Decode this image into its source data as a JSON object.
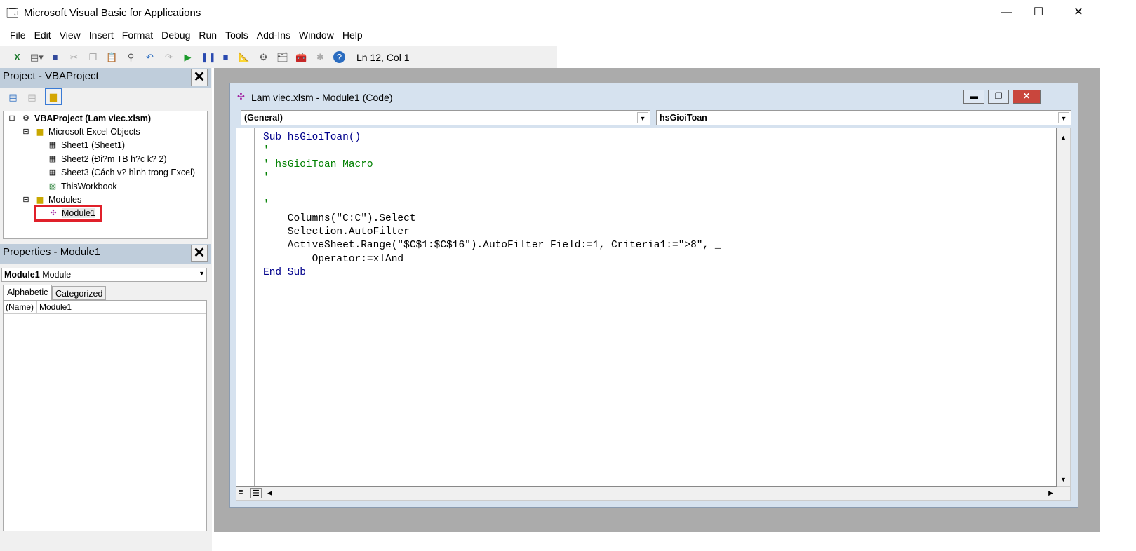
{
  "app": {
    "title": "Microsoft Visual Basic for Applications"
  },
  "menu": [
    "File",
    "Edit",
    "View",
    "Insert",
    "Format",
    "Debug",
    "Run",
    "Tools",
    "Add-Ins",
    "Window",
    "Help"
  ],
  "toolbar": {
    "position": "Ln 12, Col 1"
  },
  "project": {
    "title": "Project - VBAProject",
    "root": "VBAProject (Lam viec.xlsm)",
    "folder1": "Microsoft Excel Objects",
    "items": [
      "Sheet1 (Sheet1)",
      "Sheet2 (Đi?m TB h?c k? 2)",
      "Sheet3 (Cách v? hình trong Excel)",
      "ThisWorkbook"
    ],
    "folder2": "Modules",
    "module": "Module1"
  },
  "properties": {
    "title": "Properties - Module1",
    "object_name": "Module1",
    "object_type": "Module",
    "tabs": [
      "Alphabetic",
      "Categorized"
    ],
    "rows": [
      {
        "name": "(Name)",
        "value": "Module1"
      }
    ]
  },
  "code_window": {
    "title": "Lam viec.xlsm - Module1 (Code)",
    "object_combo": "(General)",
    "proc_combo": "hsGioiToan",
    "lines": [
      {
        "t": "Sub hsGioiToan()",
        "c": "kw"
      },
      {
        "t": "'",
        "c": "cm"
      },
      {
        "t": "' hsGioiToan Macro",
        "c": "cm"
      },
      {
        "t": "'",
        "c": "cm"
      },
      {
        "t": "",
        "c": ""
      },
      {
        "t": "'",
        "c": "cm"
      },
      {
        "t": "    Columns(\"C:C\").Select",
        "c": ""
      },
      {
        "t": "    Selection.AutoFilter",
        "c": ""
      },
      {
        "t": "    ActiveSheet.Range(\"$C$1:$C$16\").AutoFilter Field:=1, Criteria1:=\">8\", _",
        "c": ""
      },
      {
        "t": "        Operator:=xlAnd",
        "c": ""
      },
      {
        "t": "End Sub",
        "c": "kw"
      }
    ]
  }
}
